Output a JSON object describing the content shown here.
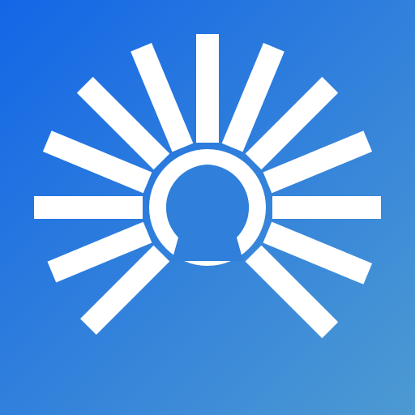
{
  "icon": {
    "name": "sunburst-logo-icon",
    "colors": {
      "background_start": "#1466e6",
      "background_end": "#4d9ad2",
      "mark": "#ffffff"
    }
  }
}
